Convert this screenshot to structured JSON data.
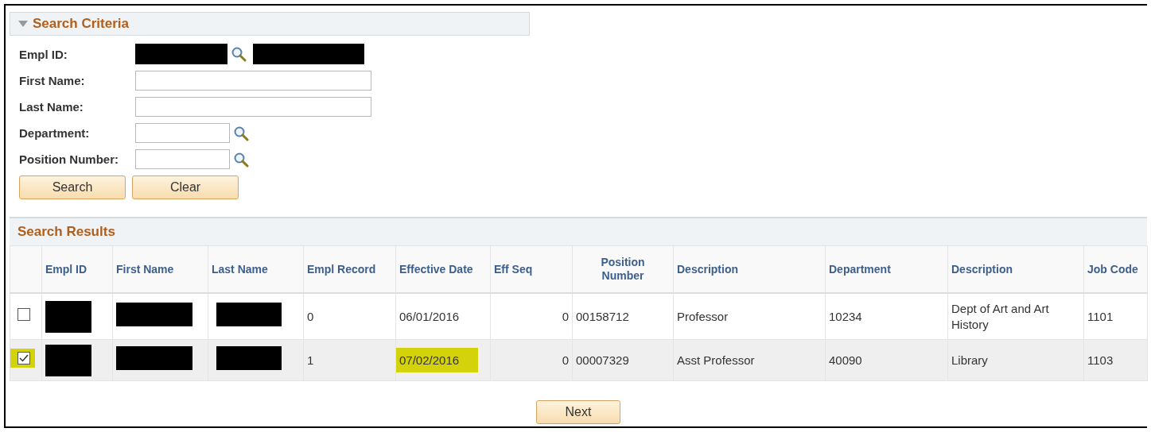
{
  "search_criteria": {
    "title": "Search Criteria",
    "expanded": true,
    "fields": [
      {
        "label": "Empl ID:",
        "kind": "redacted"
      },
      {
        "label": "First Name:",
        "kind": "wide"
      },
      {
        "label": "Last Name:",
        "kind": "wide"
      },
      {
        "label": "Department:",
        "kind": "lookup"
      },
      {
        "label": "Position Number:",
        "kind": "lookup"
      }
    ],
    "buttons": [
      "Search",
      "Clear"
    ]
  },
  "search_results": {
    "title": "Search Results",
    "columns": [
      "Empl ID",
      "First Name",
      "Last Name",
      "Empl Record",
      "Effective Date",
      "Eff Seq",
      "Position Number",
      "Description",
      "Department",
      "Description",
      "Job Code"
    ],
    "rows": [
      {
        "selected": false,
        "highlighted": false,
        "empl_record": "0",
        "effective_date": "06/01/2016",
        "date_highlighted": false,
        "eff_seq": "0",
        "position_number": "00158712",
        "description": "Professor",
        "department": "10234",
        "department_description": "Dept of Art and Art History",
        "job_code": "1101"
      },
      {
        "selected": true,
        "highlighted": true,
        "empl_record": "1",
        "effective_date": "07/02/2016",
        "date_highlighted": true,
        "eff_seq": "0",
        "position_number": "00007329",
        "description": "Asst Professor",
        "department": "40090",
        "department_description": "Library",
        "job_code": "1103"
      }
    ]
  },
  "next_button": "Next"
}
